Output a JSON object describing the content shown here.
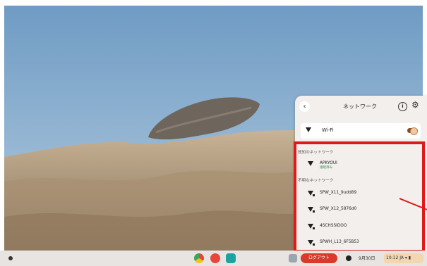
{
  "panel": {
    "title": "ネットワーク",
    "back_icon": "arrow-left-icon",
    "info_icon": "info-icon",
    "settings_icon": "gear-icon",
    "wifi": {
      "label": "Wi-Fi",
      "enabled": true
    },
    "known_section": "既知のネットワーク",
    "known_networks": [
      {
        "name": "APKYOUI",
        "status": "接続済み"
      }
    ],
    "unknown_section": "不明なネットワーク",
    "unknown_networks": [
      {
        "name": "SPW_X11_9udd89"
      },
      {
        "name": "SPW_X12_5876d0"
      },
      {
        "name": "4SCHSSIDOO"
      },
      {
        "name": "SPWH_L13_6F5B53"
      }
    ]
  },
  "shelf": {
    "logout_label": "ログアウト",
    "date": "9月30日",
    "time": "10:12 JA",
    "accent": "#d93a2a"
  },
  "colors": {
    "highlight": "#e01a1a",
    "panel_bg": "#f3efed"
  }
}
